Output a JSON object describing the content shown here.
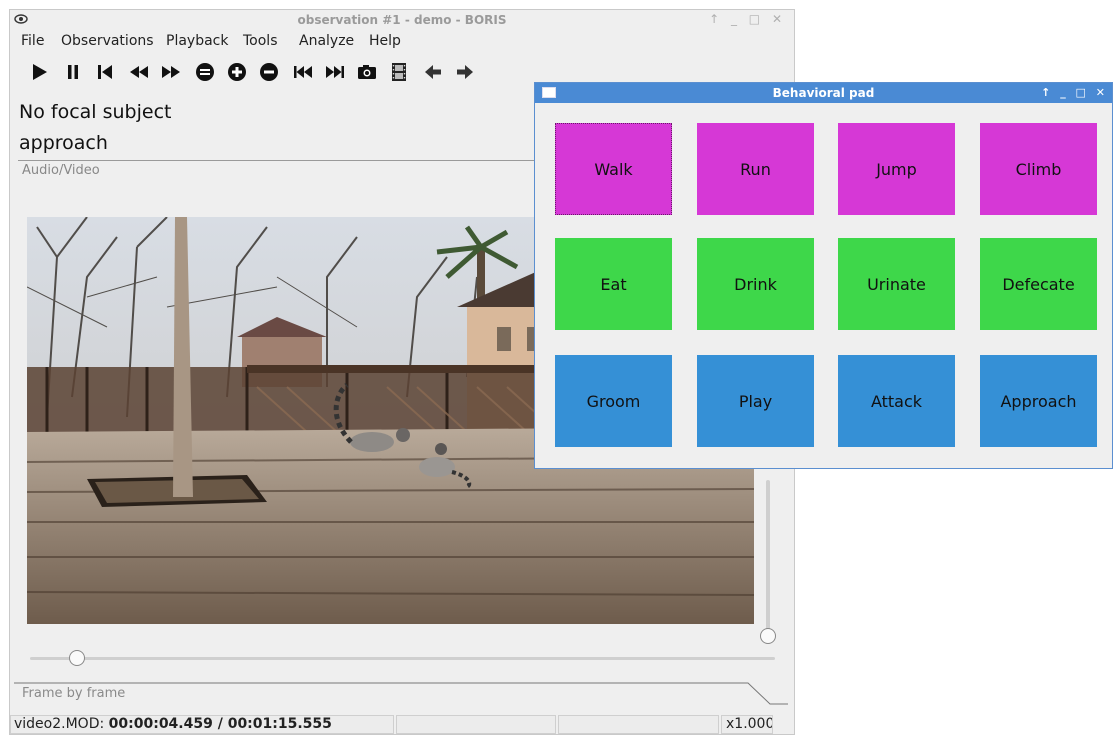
{
  "main_window": {
    "title": "observation #1 - demo - BORIS",
    "controls": "↑ _ □ ✕",
    "menu": [
      "File",
      "Observations",
      "Playback",
      "Tools",
      "Analyze",
      "Help"
    ],
    "toolbar_icons": [
      "play-icon",
      "pause-icon",
      "skip-start-icon",
      "rewind-icon",
      "fast-forward-icon",
      "equal-icon",
      "zoom-in-icon",
      "zoom-out-icon",
      "previous-track-icon",
      "next-track-icon",
      "camera-icon",
      "film-icon",
      "arrow-left-icon",
      "arrow-right-icon"
    ],
    "focal_subject": "No focal subject",
    "current_behavior": "approach",
    "av_tab_label": "Audio/Video",
    "frame_by_frame_label": "Frame by frame",
    "status": {
      "file": "video2.MOD: ",
      "time": "00:00:04.459 / 00:01:15.555",
      "speed": "x1.000"
    },
    "horizontal_slider_value": 0.05,
    "vertical_slider_value": 0.0
  },
  "behavioral_pad": {
    "title": "Behavioral pad",
    "controls": "↑ _ □ ✕",
    "buttons": [
      {
        "label": "Walk",
        "color": "#d638d6"
      },
      {
        "label": "Run",
        "color": "#d638d6"
      },
      {
        "label": "Jump",
        "color": "#d638d6"
      },
      {
        "label": "Climb",
        "color": "#d638d6"
      },
      {
        "label": "Eat",
        "color": "#3ed74a"
      },
      {
        "label": "Drink",
        "color": "#3ed74a"
      },
      {
        "label": "Urinate",
        "color": "#3ed74a"
      },
      {
        "label": "Defecate",
        "color": "#3ed74a"
      },
      {
        "label": "Groom",
        "color": "#3590d6"
      },
      {
        "label": "Play",
        "color": "#3590d6"
      },
      {
        "label": "Attack",
        "color": "#3590d6"
      },
      {
        "label": "Approach",
        "color": "#3590d6"
      }
    ]
  }
}
